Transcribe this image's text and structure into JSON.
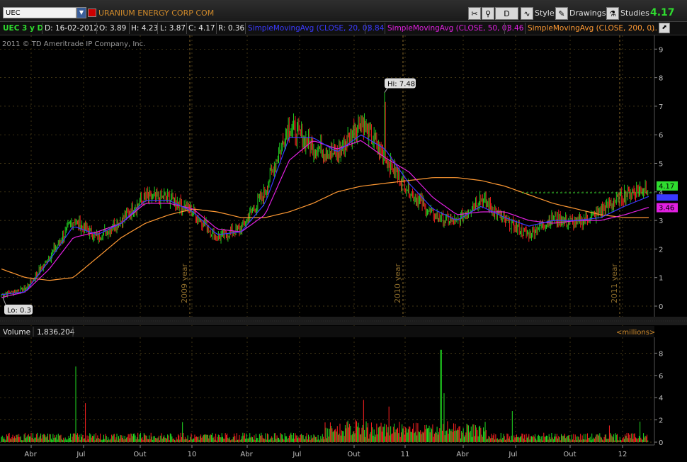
{
  "toolbar": {
    "symbol": "UEC",
    "company": "URANIUM ENERGY CORP COM",
    "period": "D",
    "style_label": "Style",
    "drawings_label": "Drawings",
    "studies_label": "Studies",
    "last_price": "4.17"
  },
  "infobar": {
    "symbol_range": "UEC 3 y D",
    "date": "D: 16-02-2012",
    "open": "O: 3.89",
    "high": "H: 4.23",
    "low": "L: 3.87",
    "close": "C: 4.17",
    "range": "R: 0.36",
    "sma20_label": "SimpleMovingAvg (CLOSE, 20, 0)",
    "sma20_value": "3.84",
    "sma50_label": "SimpleMovingAvg (CLOSE, 50, 0)",
    "sma50_value": "3.46",
    "sma200_label": "SimpleMovingAvg (CLOSE, 200, 0)",
    "more": "..."
  },
  "copyright": "2011 © TD Ameritrade IP Company, Inc.",
  "price_pane": {
    "y_ticks": [
      "0",
      "1",
      "2",
      "3",
      "4",
      "5",
      "6",
      "7",
      "8",
      "9"
    ],
    "year_labels": [
      "2009 year",
      "2010 year",
      "2011 year"
    ],
    "hi_label": "Hi: 7.48",
    "lo_label": "Lo: 0.3",
    "last_bubble": "4.17",
    "sma50_bubble": "3.46",
    "colors": {
      "up": "#22dd22",
      "down": "#ff2222",
      "sma20": "#3a3aff",
      "sma50": "#e020e0",
      "sma200": "#ff9933"
    }
  },
  "volume_pane": {
    "label": "Volume",
    "value": "1,836,204",
    "units": "<millions>",
    "y_ticks": [
      "0",
      "2",
      "4",
      "6",
      "8"
    ]
  },
  "x_axis": {
    "labels": [
      "Abr",
      "Jul",
      "Out",
      "10",
      "Abr",
      "Jul",
      "Out",
      "11",
      "Abr",
      "Jul",
      "Out",
      "12"
    ]
  },
  "chart_data": {
    "type": "line",
    "title": "UEC 3 y D",
    "ylim": [
      0,
      9
    ],
    "x": [
      "2009-01",
      "2009-03",
      "2009-05",
      "2009-06",
      "2009-08",
      "2009-10",
      "2009-12",
      "2010-02",
      "2010-04",
      "2010-06",
      "2010-08",
      "2010-10",
      "2010-11",
      "2010-12",
      "2011-01",
      "2011-02",
      "2011-03",
      "2011-04",
      "2011-05",
      "2011-06",
      "2011-07",
      "2011-08",
      "2011-09",
      "2011-10",
      "2011-11",
      "2011-12",
      "2012-01",
      "2012-02"
    ],
    "series": [
      {
        "name": "Close",
        "values": [
          0.4,
          0.6,
          1.7,
          3.0,
          2.4,
          3.0,
          3.8,
          3.8,
          3.3,
          2.4,
          2.7,
          4.0,
          6.3,
          5.6,
          5.3,
          6.5,
          5.2,
          4.1,
          3.2,
          2.9,
          3.8,
          3.0,
          2.5,
          3.1,
          2.9,
          3.3,
          3.9,
          4.17
        ]
      },
      {
        "name": "SimpleMovingAvg (CLOSE, 20, 0)",
        "values": [
          0.4,
          0.5,
          1.6,
          2.8,
          2.5,
          2.9,
          3.7,
          3.7,
          3.3,
          2.5,
          2.6,
          3.6,
          5.9,
          5.9,
          5.4,
          6.0,
          5.5,
          4.3,
          3.4,
          3.0,
          3.5,
          3.1,
          2.8,
          3.0,
          3.0,
          3.1,
          3.5,
          3.84
        ]
      },
      {
        "name": "SimpleMovingAvg (CLOSE, 50, 0)",
        "values": [
          0.3,
          0.5,
          1.3,
          2.4,
          2.6,
          2.9,
          3.6,
          3.6,
          3.4,
          2.7,
          2.6,
          3.2,
          5.1,
          5.8,
          5.5,
          5.8,
          5.2,
          4.7,
          3.8,
          3.2,
          3.3,
          3.3,
          3.0,
          2.9,
          3.0,
          3.0,
          3.2,
          3.46
        ]
      },
      {
        "name": "SimpleMovingAvg (CLOSE, 200, 0)",
        "values": [
          1.3,
          1.0,
          0.9,
          1.0,
          1.7,
          2.4,
          2.9,
          3.2,
          3.4,
          3.3,
          3.1,
          3.1,
          3.3,
          3.6,
          4.0,
          4.2,
          4.3,
          4.4,
          4.5,
          4.5,
          4.4,
          4.2,
          3.9,
          3.6,
          3.4,
          3.2,
          3.1,
          3.1
        ]
      }
    ],
    "volume": {
      "ylabel": "millions",
      "ylim": [
        0,
        8.5
      ],
      "x": [
        "2009-02",
        "2009-06",
        "2009-07",
        "2010-02",
        "2010-10",
        "2010-11",
        "2011-03",
        "2011-03-b",
        "2011-06",
        "2011-08",
        "2011-12",
        "2012-02"
      ],
      "values": [
        0.6,
        6.8,
        3.5,
        1.8,
        3.8,
        3.2,
        8.3,
        4.4,
        1.6,
        2.8,
        1.5,
        1.84
      ]
    },
    "annotations": [
      "Hi: 7.48",
      "Lo: 0.3"
    ]
  }
}
